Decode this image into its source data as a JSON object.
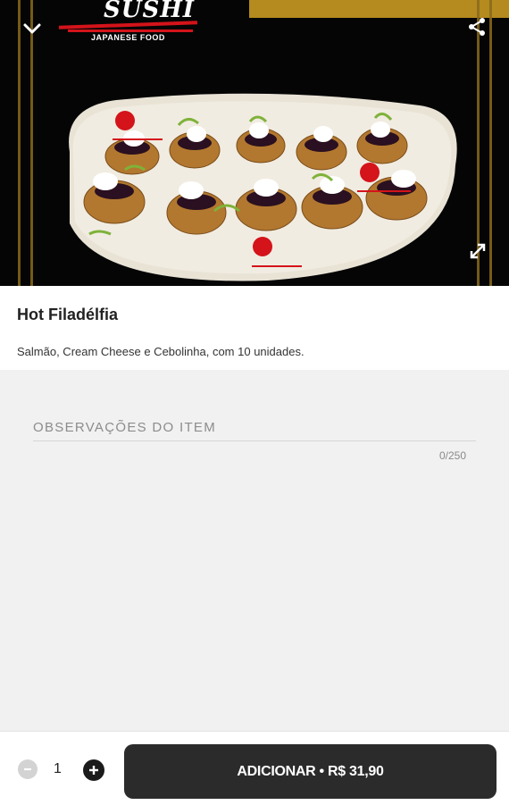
{
  "brand": {
    "name": "SUSHI",
    "subtitle": "JAPANESE FOOD"
  },
  "hero": {
    "image_label": "Hot Filadélfia",
    "collapse_icon": "chevron-down-icon",
    "share_icon": "share-icon",
    "expand_icon": "expand-icon"
  },
  "item": {
    "title": "Hot Filadélfia",
    "description": "Salmão, Cream Cheese e Cebolinha, com 10 unidades."
  },
  "observations": {
    "placeholder": "OBSERVAÇÕES DO ITEM",
    "value": "",
    "counter": "0/250"
  },
  "footer": {
    "quantity": "1",
    "add_label": "ADICIONAR",
    "separator": "•",
    "price": "R$ 31,90"
  },
  "colors": {
    "accent_gold": "#b58a1e",
    "button_dark": "#2b2b2b",
    "brand_red": "#d4131a"
  }
}
